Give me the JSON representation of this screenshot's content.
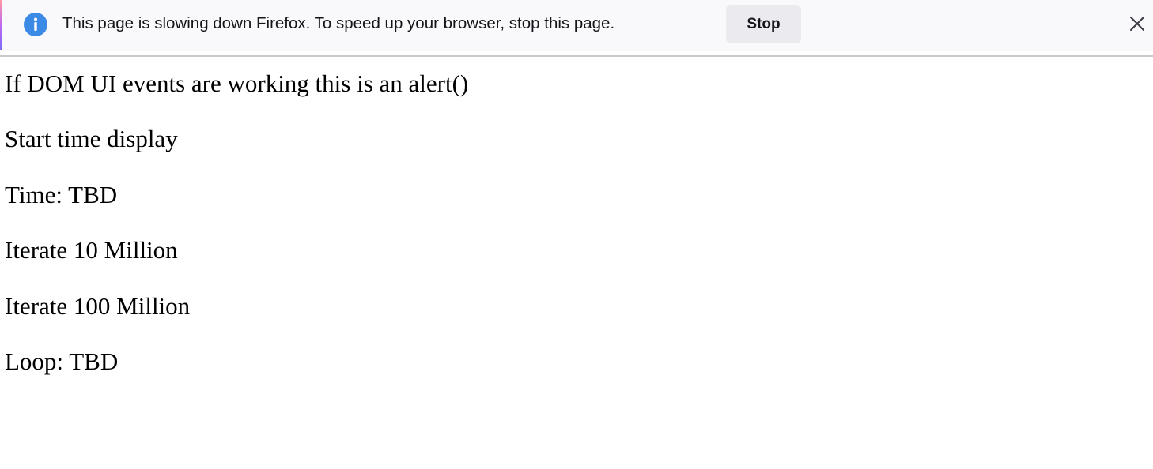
{
  "notification": {
    "message": "This page is slowing down Firefox. To speed up your browser, stop this page.",
    "stop_label": "Stop",
    "info_icon": "info-icon",
    "close_icon": "close-icon",
    "info_color": "#3b8ae6"
  },
  "page": {
    "alert_text": "If DOM UI events are working this is an alert()",
    "start_time_link": "Start time display",
    "time_status": "Time: TBD",
    "iterate_10m_link": "Iterate 10 Million",
    "iterate_100m_link": "Iterate 100 Million",
    "loop_status": "Loop: TBD"
  }
}
